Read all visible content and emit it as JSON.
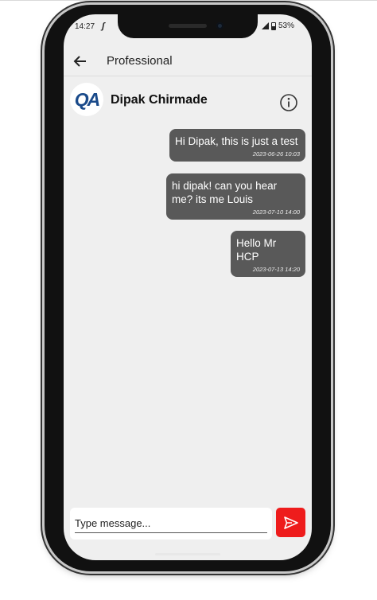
{
  "status_bar": {
    "time": "14:27",
    "notification_glyph": "ʃ",
    "battery_percent": "53%"
  },
  "header": {
    "title": "Professional",
    "back_icon": "arrow-left-icon"
  },
  "contact": {
    "avatar_text": "QA",
    "name": "Dipak Chirmade",
    "info_icon": "info-circle-icon"
  },
  "messages": [
    {
      "text": "Hi Dipak, this is just a test",
      "timestamp": "2023-06-26 10:03"
    },
    {
      "text": "hi dipak! can you hear me? its me Louis",
      "timestamp": "2023-07-10 14:00"
    },
    {
      "text": "Hello Mr HCP",
      "timestamp": "2023-07-13 14:20"
    }
  ],
  "composer": {
    "placeholder": "Type message...",
    "value": "",
    "send_icon": "send-icon"
  },
  "colors": {
    "bubble": "#595959",
    "send_button": "#ee1c1c",
    "screen_bg": "#efefef",
    "avatar_text": "#1a4a8a"
  }
}
